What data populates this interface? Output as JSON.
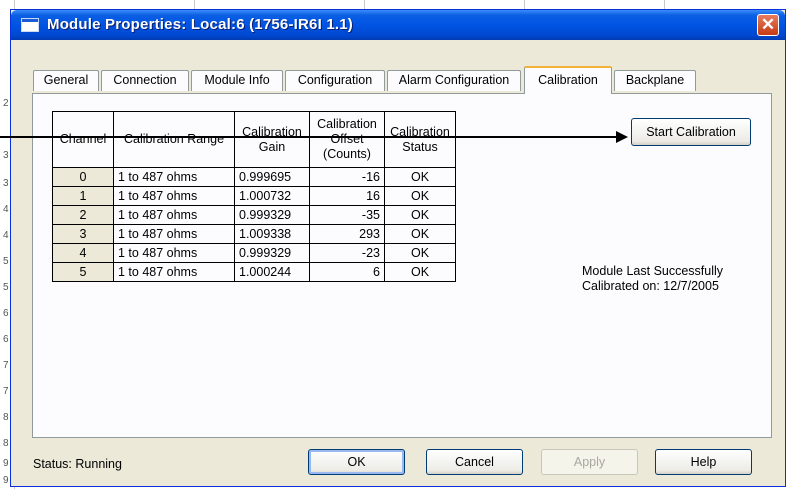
{
  "background_rows": [
    "2",
    "3",
    "3",
    "4",
    "4",
    "5",
    "5",
    "6",
    "6",
    "7",
    "7",
    "8",
    "8",
    "9",
    "9"
  ],
  "window": {
    "title": "Module Properties: Local:6 (1756-IR6I 1.1)",
    "close_label": "✕"
  },
  "tabs": [
    {
      "label": "General",
      "active": false
    },
    {
      "label": "Connection",
      "active": false
    },
    {
      "label": "Module Info",
      "active": false
    },
    {
      "label": "Configuration",
      "active": false
    },
    {
      "label": "Alarm Configuration",
      "active": false
    },
    {
      "label": "Calibration",
      "active": true
    },
    {
      "label": "Backplane",
      "active": false
    }
  ],
  "table": {
    "headers": [
      "Channel",
      "Calibration Range",
      "Calibration Gain",
      "Calibration Offset (Counts)",
      "Calibration Status"
    ],
    "rows": [
      {
        "channel": "0",
        "range": "1 to 487 ohms",
        "gain": "0.999695",
        "offset": "-16",
        "status": "OK"
      },
      {
        "channel": "1",
        "range": "1 to 487 ohms",
        "gain": "1.000732",
        "offset": "16",
        "status": "OK"
      },
      {
        "channel": "2",
        "range": "1 to 487 ohms",
        "gain": "0.999329",
        "offset": "-35",
        "status": "OK"
      },
      {
        "channel": "3",
        "range": "1 to 487 ohms",
        "gain": "1.009338",
        "offset": "293",
        "status": "OK"
      },
      {
        "channel": "4",
        "range": "1 to 487 ohms",
        "gain": "0.999329",
        "offset": "-23",
        "status": "OK"
      },
      {
        "channel": "5",
        "range": "1 to 487 ohms",
        "gain": "1.000244",
        "offset": "6",
        "status": "OK"
      }
    ]
  },
  "start_calibration_label": "Start Calibration",
  "last_calibration": {
    "line1": "Module Last Successfully",
    "line2": "Calibrated on:  12/7/2005"
  },
  "status_text": "Status:  Running",
  "buttons": {
    "ok": "OK",
    "cancel": "Cancel",
    "apply": "Apply",
    "help": "Help"
  }
}
